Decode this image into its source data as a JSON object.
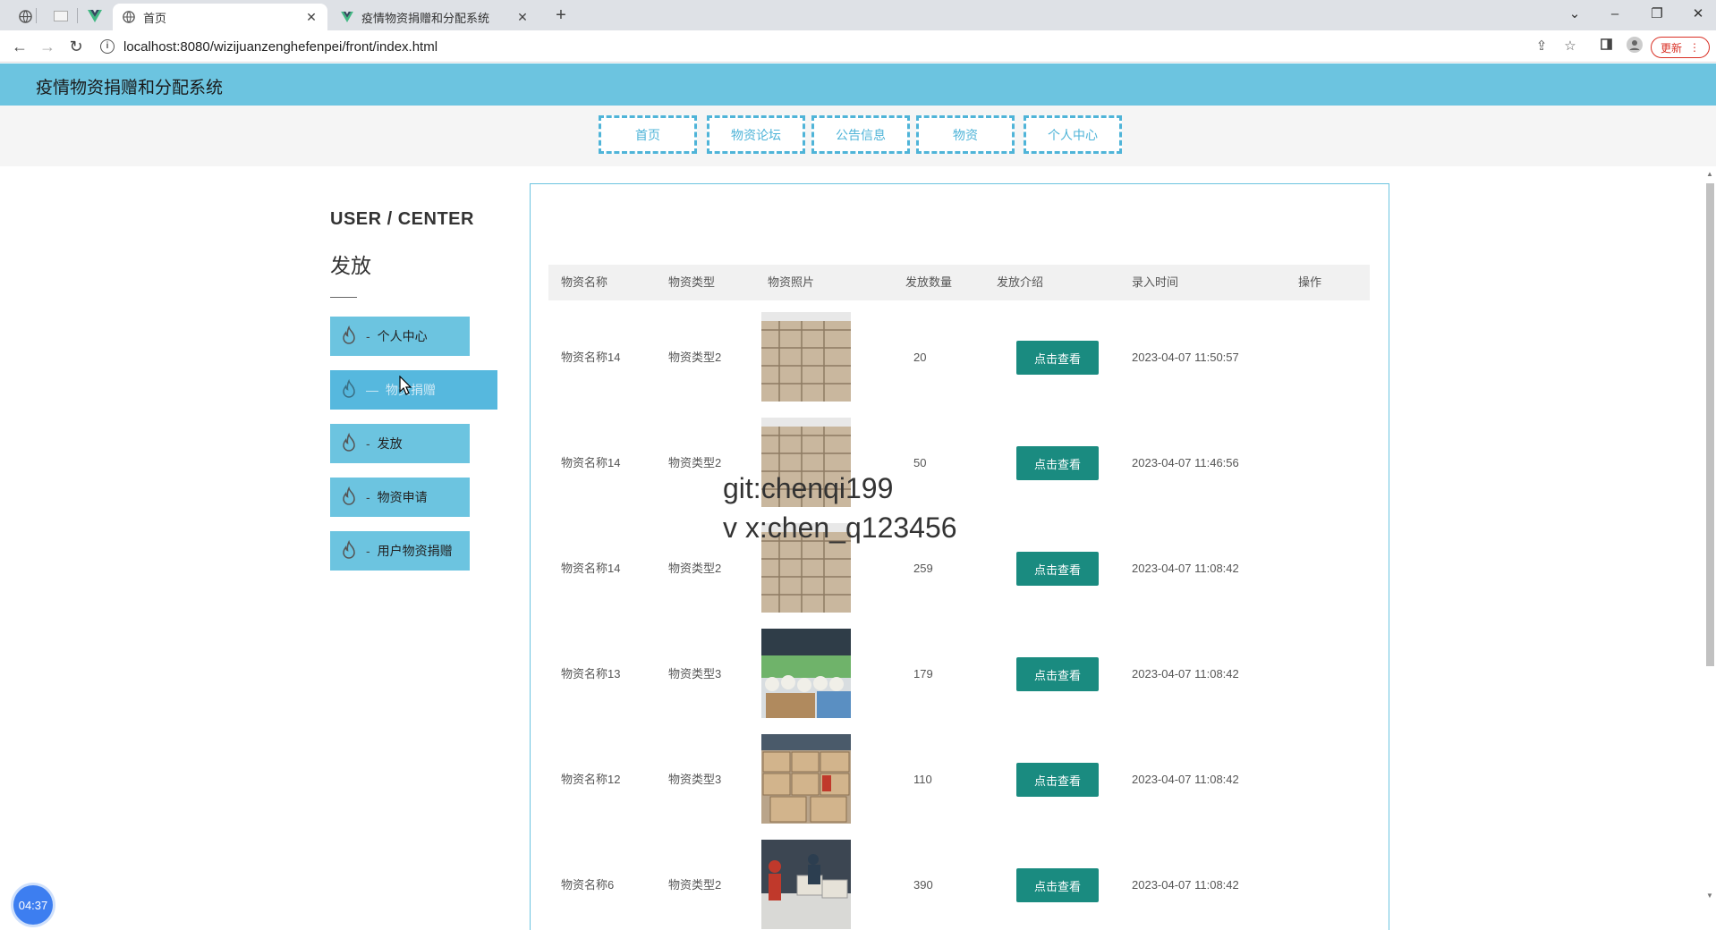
{
  "browser": {
    "tabs": [
      {
        "title": "首页",
        "active": true,
        "icon": "globe-icon"
      },
      {
        "title": "疫情物资捐赠和分配系统",
        "active": false,
        "icon": "vue-logo-icon"
      }
    ],
    "url": "localhost:8080/wizijuanzenghefenpei/front/index.html",
    "update_label": "更新"
  },
  "site": {
    "title": "疫情物资捐赠和分配系统",
    "nav": [
      "首页",
      "物资论坛",
      "公告信息",
      "物资",
      "个人中心"
    ]
  },
  "sidebar": {
    "heading": "USER / CENTER",
    "subheading": "发放",
    "items": [
      {
        "label": "个人中心",
        "active": false
      },
      {
        "label": "物资捐赠",
        "active": true
      },
      {
        "label": "发放",
        "active": false
      },
      {
        "label": "物资申请",
        "active": false
      },
      {
        "label": "用户物资捐赠",
        "active": false
      }
    ]
  },
  "table": {
    "columns": [
      "物资名称",
      "物资类型",
      "物资照片",
      "发放数量",
      "发放介绍",
      "录入时间",
      "操作"
    ],
    "view_label": "点击查看",
    "rows": [
      {
        "name": "物资名称14",
        "type": "物资类型2",
        "quantity": "20",
        "time": "2023-04-07 11:50:57",
        "photo": "boxes"
      },
      {
        "name": "物资名称14",
        "type": "物资类型2",
        "quantity": "50",
        "time": "2023-04-07 11:46:56",
        "photo": "boxes"
      },
      {
        "name": "物资名称14",
        "type": "物资类型2",
        "quantity": "259",
        "time": "2023-04-07 11:08:42",
        "photo": "boxes"
      },
      {
        "name": "物资名称13",
        "type": "物资类型3",
        "quantity": "179",
        "time": "2023-04-07 11:08:42",
        "photo": "bottles"
      },
      {
        "name": "物资名称12",
        "type": "物资类型3",
        "quantity": "110",
        "time": "2023-04-07 11:08:42",
        "photo": "warehouse"
      },
      {
        "name": "物资名称6",
        "type": "物资类型2",
        "quantity": "390",
        "time": "2023-04-07 11:08:42",
        "photo": "workers"
      }
    ]
  },
  "overlay": {
    "watermark_line1": "git:chenqi199",
    "watermark_line2": "v x:chen_q123456",
    "timer": "04:37"
  },
  "colors": {
    "header": "#6cc4e0",
    "nav_border": "#4fb4d8",
    "button": "#1a8b80"
  }
}
